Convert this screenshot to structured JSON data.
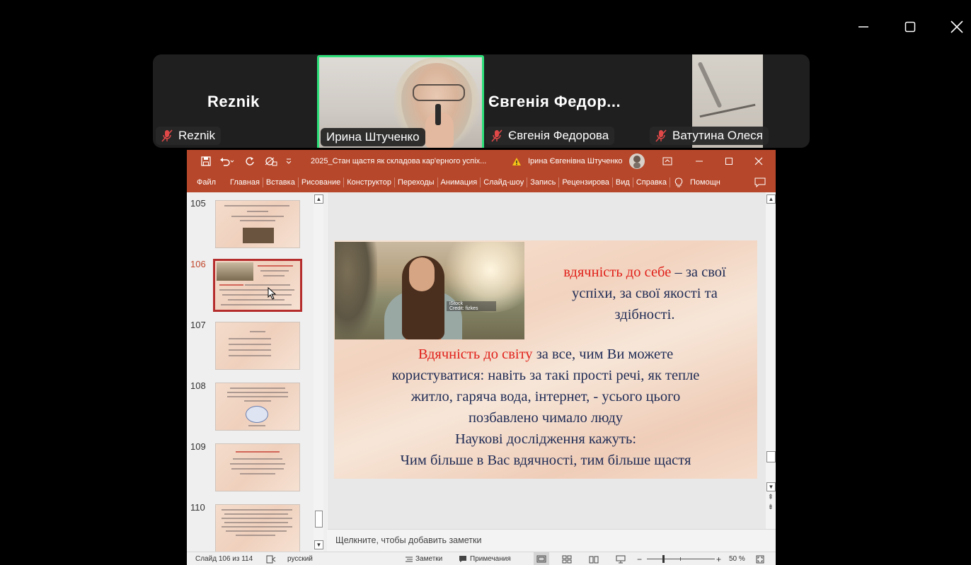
{
  "window_controls": {
    "minimize_icon": "minimize-icon",
    "maximize_icon": "maximize-icon",
    "close_icon": "close-icon"
  },
  "participants": [
    {
      "display": "Reznik",
      "tag": "Reznik",
      "muted": true
    },
    {
      "display": "",
      "tag": "Ирина Штученко",
      "muted": false,
      "speaking": true
    },
    {
      "display": "Євгенія Федор...",
      "tag": "Євгенія Федорова",
      "muted": true
    },
    {
      "display": "",
      "tag": "Ватутина Олеся",
      "muted": true
    }
  ],
  "ppt": {
    "file_title": "2025_Стан щастя як складова кар'ерного успіх...",
    "user_name": "Ірина Євгенівна Штученко",
    "ribbon_tabs": [
      "Файл",
      "Главная",
      "Вставка",
      "Рисование",
      "Конструктор",
      "Переходы",
      "Анимация",
      "Слайд-шоу",
      "Запись",
      "Рецензирова",
      "Вид",
      "Справка"
    ],
    "help_label": "Помощн",
    "thumbnails": [
      {
        "number": "105",
        "active": false
      },
      {
        "number": "106",
        "active": true
      },
      {
        "number": "107",
        "active": false
      },
      {
        "number": "108",
        "active": false
      },
      {
        "number": "109",
        "active": false
      },
      {
        "number": "110",
        "active": false
      }
    ],
    "slide": {
      "photo_watermark": "iStock",
      "photo_credit": "Credit: fizkes",
      "heading_red": "вдячність до себе",
      "heading_rest_1": " – за свої",
      "heading_line_2": "успіхи, за свої якості та",
      "heading_line_3": "здібності.",
      "body_red": "Вдячність до світу",
      "body_rest_1": " за все, чим Ви можете",
      "body_line_2": "користуватися: навіть за такі прості речі, як тепле",
      "body_line_3": "житло, гаряча вода, інтернет, - усього цього",
      "body_line_4": "позбавлено чимало люду",
      "body_line_5": "Наукові дослідження кажуть:",
      "body_line_6": "Чим більше в Вас вдячності, тим більше щастя"
    },
    "notes_placeholder": "Щелкните, чтобы добавить заметки",
    "status": {
      "slide_counter": "Слайд 106 из 114",
      "language": "русский",
      "notes_label": "Заметки",
      "comments_label": "Примечания",
      "zoom": "50 %"
    }
  }
}
